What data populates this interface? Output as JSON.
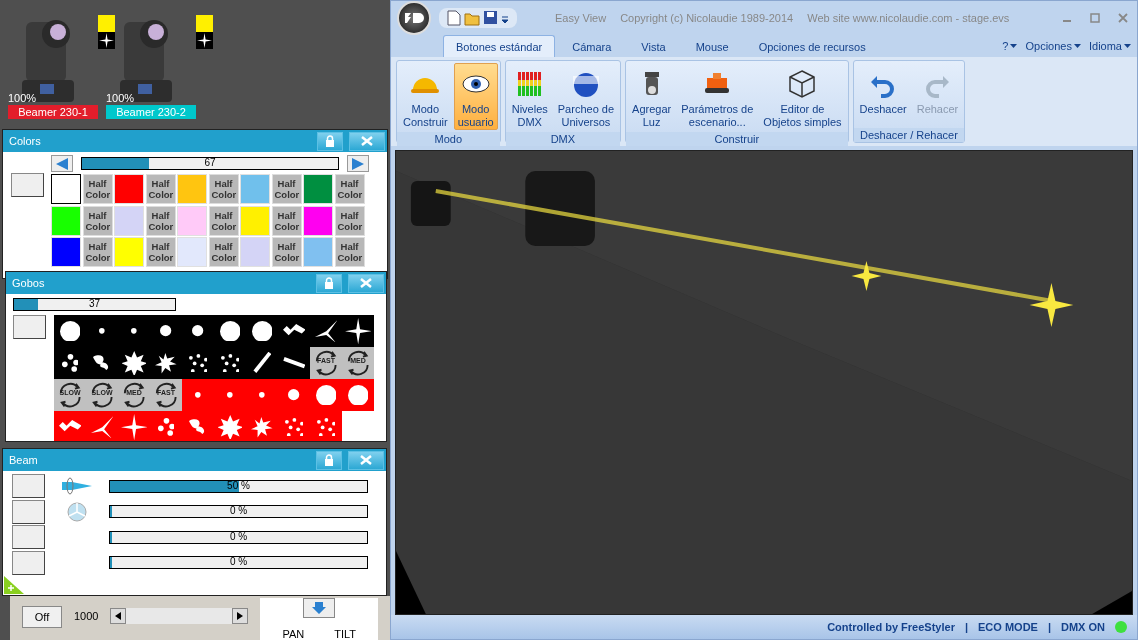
{
  "fixtures": [
    {
      "name": "Beamer 230-1",
      "intensity": "100%",
      "color": "#e21d2b"
    },
    {
      "name": "Beamer 230-2",
      "intensity": "100%",
      "color": "#00c8cc"
    }
  ],
  "colors_window": {
    "title": "Colors",
    "slider": {
      "level": 0.26,
      "reading": "67"
    },
    "swatches": [
      {
        "kind": "color",
        "color": "#ffffff",
        "selected": true
      },
      {
        "kind": "half",
        "label": "Half Color"
      },
      {
        "kind": "color",
        "color": "#ff0000",
        "selected": false
      },
      {
        "kind": "half",
        "label": "Half Color"
      },
      {
        "kind": "color",
        "color": "#ffc510",
        "selected": false
      },
      {
        "kind": "half",
        "label": "Half Color"
      },
      {
        "kind": "color",
        "color": "#70c0ec",
        "selected": false
      },
      {
        "kind": "half",
        "label": "Half Color"
      },
      {
        "kind": "color",
        "color": "#008f40",
        "selected": false
      },
      {
        "kind": "half",
        "label": "Half Color"
      },
      {
        "kind": "color",
        "color": "#18ff00",
        "selected": false
      },
      {
        "kind": "half",
        "label": "Half Color"
      },
      {
        "kind": "color",
        "color": "#d4d4f6",
        "selected": false
      },
      {
        "kind": "half",
        "label": "Half Color"
      },
      {
        "kind": "color",
        "color": "#ffcaf8",
        "selected": false
      },
      {
        "kind": "half",
        "label": "Half Color"
      },
      {
        "kind": "color",
        "color": "#fff000",
        "selected": false
      },
      {
        "kind": "half",
        "label": "Half Color"
      },
      {
        "kind": "color",
        "color": "#ff00f0",
        "selected": false
      },
      {
        "kind": "half",
        "label": "Half Color"
      },
      {
        "kind": "color",
        "color": "#0000ff",
        "selected": false
      },
      {
        "kind": "half",
        "label": "Half Color"
      },
      {
        "kind": "color",
        "color": "#ffff00",
        "selected": false
      },
      {
        "kind": "half",
        "label": "Half Color"
      },
      {
        "kind": "color",
        "color": "#e2e8fc",
        "selected": false
      },
      {
        "kind": "half",
        "label": "Half Color"
      },
      {
        "kind": "color",
        "color": "#d4d4f6",
        "selected": false
      },
      {
        "kind": "half",
        "label": "Half Color"
      },
      {
        "kind": "color",
        "color": "#80c0f0",
        "selected": false
      },
      {
        "kind": "half",
        "label": "Half Color"
      }
    ]
  },
  "gobos_window": {
    "title": "Gobos",
    "slider": {
      "level": 0.15,
      "reading": "37"
    },
    "gobos": [
      {
        "kind": "bigdisc",
        "color": "#000000"
      },
      {
        "kind": "dot",
        "color": "#000000"
      },
      {
        "kind": "dot",
        "color": "#000000"
      },
      {
        "kind": "disc",
        "color": "#000000"
      },
      {
        "kind": "disc",
        "color": "#000000"
      },
      {
        "kind": "bigdisc",
        "color": "#000000"
      },
      {
        "kind": "bigdisc",
        "color": "#000000"
      },
      {
        "kind": "break",
        "color": "#000000"
      },
      {
        "kind": "tri",
        "color": "#000000"
      },
      {
        "kind": "star",
        "color": "#000000"
      },
      {
        "kind": "dots",
        "color": "#000000"
      },
      {
        "kind": "swirl",
        "color": "#000000"
      },
      {
        "kind": "burst",
        "color": "#000000"
      },
      {
        "kind": "splat",
        "color": "#000000"
      },
      {
        "kind": "scatter",
        "color": "#000000"
      },
      {
        "kind": "scatter",
        "color": "#000000"
      },
      {
        "kind": "line",
        "color": "#000000"
      },
      {
        "kind": "bar",
        "color": "#000000"
      },
      {
        "kind": "rotate",
        "color": "#c0c0c0",
        "label": "FAST"
      },
      {
        "kind": "rotate",
        "color": "#c0c0c0",
        "label": "MED"
      },
      {
        "kind": "rotate",
        "color": "#c0c0c0",
        "label": "SLOW"
      },
      {
        "kind": "rotate",
        "color": "#c0c0c0",
        "label": "SLOW"
      },
      {
        "kind": "rotate",
        "color": "#c0c0c0",
        "label": "MED"
      },
      {
        "kind": "rotate",
        "color": "#c0c0c0",
        "label": "FAST"
      },
      {
        "kind": "dot",
        "color": "#ff0000"
      },
      {
        "kind": "dot",
        "color": "#ff0000"
      },
      {
        "kind": "dot",
        "color": "#ff0000"
      },
      {
        "kind": "disc",
        "color": "#ff0000"
      },
      {
        "kind": "bigdisc",
        "color": "#ff0000"
      },
      {
        "kind": "bigdisc",
        "color": "#ff0000"
      },
      {
        "kind": "break",
        "color": "#ff0000"
      },
      {
        "kind": "tri",
        "color": "#ff0000"
      },
      {
        "kind": "star",
        "color": "#ff0000"
      },
      {
        "kind": "dots",
        "color": "#ff0000"
      },
      {
        "kind": "swirl",
        "color": "#ff0000"
      },
      {
        "kind": "burst",
        "color": "#ff0000"
      },
      {
        "kind": "splat",
        "color": "#ff0000"
      },
      {
        "kind": "scatter",
        "color": "#ff0000"
      },
      {
        "kind": "scatter",
        "color": "#ff0000"
      }
    ]
  },
  "beam_window": {
    "title": "Beam",
    "rows": [
      {
        "kind": "zoom",
        "level": 0.5,
        "reading": "50 %"
      },
      {
        "kind": "iris",
        "level": 0.0,
        "reading": "0 %"
      },
      {
        "kind": "plain",
        "level": 0.0,
        "reading": "0 %"
      },
      {
        "kind": "plain",
        "level": 0.0,
        "reading": "0 %"
      }
    ]
  },
  "back_panel": {
    "button": "Off",
    "value": "1000",
    "labels": [
      "PAN",
      "TILT"
    ]
  },
  "app": {
    "title_parts": [
      "Easy View",
      "Copyright (c) Nicolaudie 1989-2014",
      "Web site www.nicolaudie.com - stage.evs"
    ],
    "tabs": [
      {
        "label": "Botones estándar",
        "selected": true
      },
      {
        "label": "Cámara",
        "selected": false
      },
      {
        "label": "Vista",
        "selected": false
      },
      {
        "label": "Mouse",
        "selected": false
      },
      {
        "label": "Opciones de recursos",
        "selected": false
      }
    ],
    "menus": [
      "?",
      "Opciones",
      "Idioma"
    ],
    "groups": [
      {
        "title": "Modo",
        "buttons": [
          {
            "label": "Modo\nConstruir",
            "kind": "helmet",
            "selected": false,
            "disabled": false
          },
          {
            "label": "Modo\nusuario",
            "kind": "eye",
            "selected": true,
            "disabled": false
          }
        ]
      },
      {
        "title": "DMX",
        "buttons": [
          {
            "label": "Niveles\nDMX",
            "kind": "meter",
            "selected": false,
            "disabled": false
          },
          {
            "label": "Parcheo de\nUniversos",
            "kind": "globe",
            "selected": false,
            "disabled": false
          }
        ]
      },
      {
        "title": "Construir",
        "buttons": [
          {
            "label": "Agregar\nLuz",
            "kind": "lamp",
            "selected": false,
            "disabled": false
          },
          {
            "label": "Parámetros de\nescenario...",
            "kind": "truck",
            "selected": false,
            "disabled": false
          },
          {
            "label": "Editor de\nObjetos simples",
            "kind": "cube",
            "selected": false,
            "disabled": false
          }
        ]
      },
      {
        "title": "Deshacer / Rehacer",
        "buttons": [
          {
            "label": "Deshacer",
            "kind": "undo",
            "selected": false,
            "disabled": false
          },
          {
            "label": "Rehacer",
            "kind": "redo",
            "selected": false,
            "disabled": true
          }
        ]
      }
    ],
    "status_bar": {
      "items": [
        "Controlled by FreeStyler",
        "|",
        "ECO MODE",
        "|",
        "DMX ON"
      ],
      "dmx_on": true
    }
  }
}
